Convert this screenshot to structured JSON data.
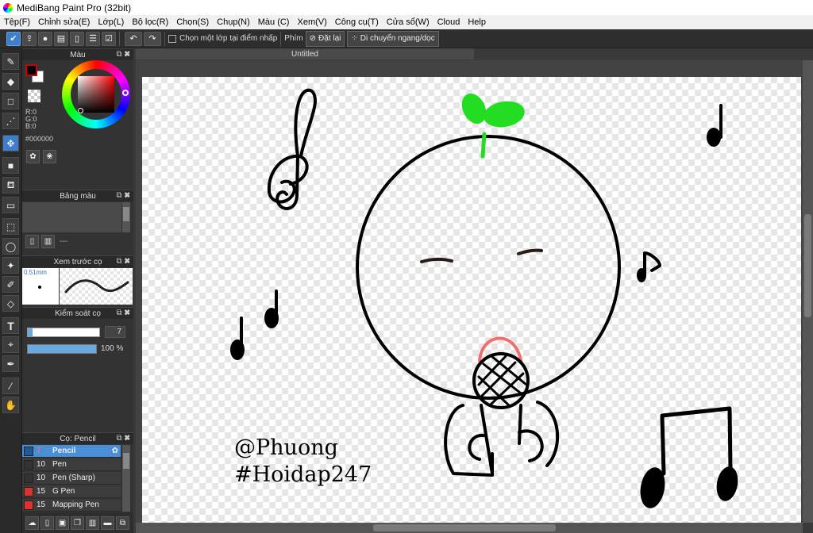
{
  "window": {
    "title": "MediBang Paint Pro (32bit)"
  },
  "menu": [
    "Tệp(F)",
    "Chỉnh sửa(E)",
    "Lớp(L)",
    "Bộ lọc(R)",
    "Chọn(S)",
    "Chụp(N)",
    "Màu (C)",
    "Xem(V)",
    "Công cụ(T)",
    "Cửa sổ(W)",
    "Cloud",
    "Help"
  ],
  "toolbar": {
    "select_layer_label": "Chọn một lớp tại điểm nhấp",
    "key_label": "Phím",
    "reset_label": "Đặt lại",
    "move_label": "Di chuyển ngang/dọc"
  },
  "panels": {
    "color": {
      "title": "Màu",
      "r": "R:0",
      "g": "G:0",
      "b": "B:0",
      "hex": "#000000",
      "primary": "#000000",
      "secondary": "#ffffff"
    },
    "palette": {
      "title": "Bảng màu",
      "dashes": "---"
    },
    "brush_preview": {
      "title": "Xem trước cọ",
      "size": "0.51mm"
    },
    "brush_control": {
      "title": "Kiểm soát cọ",
      "size_value": "7",
      "size_fraction": 0.07,
      "opacity": "100 %",
      "opacity_fraction": 1.0
    },
    "brush_list": {
      "title": "Cọ: Pencil",
      "items": [
        {
          "size": "7",
          "name": "Pencil",
          "color": "#1f5a9a",
          "selected": true
        },
        {
          "size": "10",
          "name": "Pen",
          "color": "#333333",
          "selected": false
        },
        {
          "size": "10",
          "name": "Pen (Sharp)",
          "color": "#333333",
          "selected": false
        },
        {
          "size": "15",
          "name": "G Pen",
          "color": "#e03030",
          "selected": false
        },
        {
          "size": "15",
          "name": "Mapping Pen",
          "color": "#e03030",
          "selected": false
        }
      ]
    }
  },
  "document": {
    "tab_title": "Untitled",
    "signature_line1": "@Phuong",
    "signature_line2": "#Hoidap247"
  },
  "colors": {
    "accent": "#3c7dcc",
    "sprout": "#22dd22",
    "headphone": "#f07070"
  }
}
